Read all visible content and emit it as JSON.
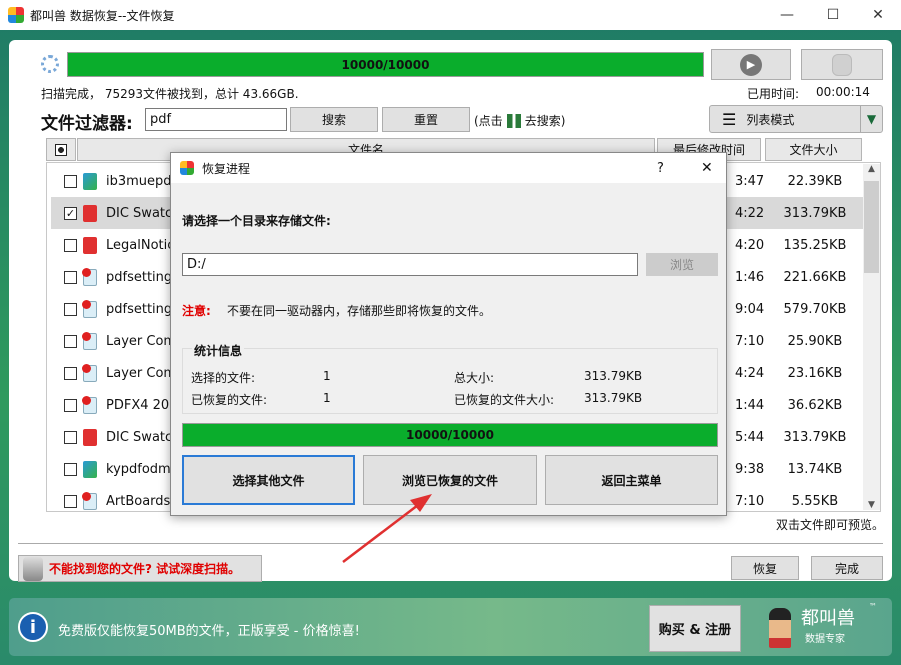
{
  "window": {
    "title": "都叫兽 数据恢复--文件恢复",
    "min": "—",
    "max": "☐",
    "close": "✕"
  },
  "scan": {
    "progress_text": "10000/10000",
    "progress": 1.0,
    "status": "扫描完成， 75293文件被找到，总计 43.66GB.",
    "elapsed_label": "已用时间:",
    "elapsed": "00:00:14"
  },
  "filter": {
    "label": "文件过滤器:",
    "value": "pdf",
    "search": "搜索",
    "reset": "重置",
    "hint_pre": "(点击",
    "hint_post": "去搜索)",
    "view_mode": "列表模式"
  },
  "columns": {
    "name": "文件名",
    "modified": "最后修改时间",
    "size": "文件大小"
  },
  "files": [
    {
      "name": "ib3muepdf",
      "time": "3:47",
      "size": "22.39KB",
      "checked": false,
      "icon": "app"
    },
    {
      "name": "DIC Swatch",
      "time": "4:22",
      "size": "313.79KB",
      "checked": true,
      "icon": "pdf"
    },
    {
      "name": "LegalNotic",
      "time": "4:20",
      "size": "135.25KB",
      "checked": false,
      "icon": "pdf"
    },
    {
      "name": "pdfsettings",
      "time": "1:46",
      "size": "221.66KB",
      "checked": false,
      "icon": "settings"
    },
    {
      "name": "pdfsettings",
      "time": "9:04",
      "size": "579.70KB",
      "checked": false,
      "icon": "settings"
    },
    {
      "name": "Layer Comp",
      "time": "7:10",
      "size": "25.90KB",
      "checked": false,
      "icon": "doc"
    },
    {
      "name": "Layer Comp",
      "time": "4:24",
      "size": "23.16KB",
      "checked": false,
      "icon": "doc"
    },
    {
      "name": "PDFX4 2008",
      "time": "1:44",
      "size": "36.62KB",
      "checked": false,
      "icon": "doc"
    },
    {
      "name": "DIC Swatch",
      "time": "5:44",
      "size": "313.79KB",
      "checked": false,
      "icon": "pdf"
    },
    {
      "name": "kypdfodmp",
      "time": "9:38",
      "size": "13.74KB",
      "checked": false,
      "icon": "app"
    },
    {
      "name": "ArtBoards",
      "time": "7:10",
      "size": "5.55KB",
      "checked": false,
      "icon": "doc"
    }
  ],
  "preview_hint": "双击文件即可预览。",
  "deep_scan": "不能找到您的文件? 试试深度扫描。",
  "actions": {
    "recover": "恢复",
    "done": "完成"
  },
  "dialog": {
    "title": "恢复进程",
    "help": "?",
    "close": "✕",
    "prompt": "请选择一个目录来存储文件:",
    "path": "D:/",
    "browse": "浏览",
    "note_label": "注意:",
    "note": "不要在同一驱动器内，存储那些即将恢复的文件。",
    "stats_title": "统计信息",
    "selected_label": "选择的文件:",
    "selected": "1",
    "total_size_label": "总大小:",
    "total_size": "313.79KB",
    "recovered_label": "已恢复的文件:",
    "recovered": "1",
    "recovered_size_label": "已恢复的文件大小:",
    "recovered_size": "313.79KB",
    "progress_text": "10000/10000",
    "progress": 1.0,
    "btn_other": "选择其他文件",
    "btn_browse": "浏览已恢复的文件",
    "btn_main": "返回主菜单"
  },
  "banner": {
    "text": "免费版仅能恢复50MB的文件，正版享受 - 价格惊喜!",
    "buy": "购买 & 注册",
    "logo_text": "都叫兽",
    "logo_sub": "数据专家",
    "tm": "™"
  },
  "colors": {
    "progress": "#0aad2c",
    "warning": "#e00000",
    "arrow": "#e03030"
  }
}
